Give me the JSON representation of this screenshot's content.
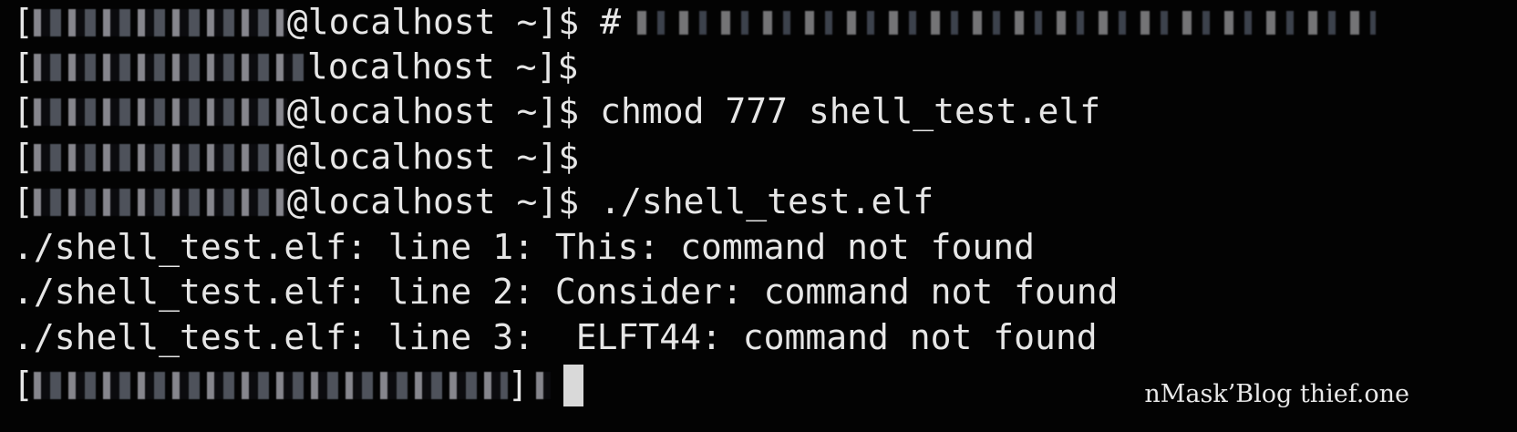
{
  "terminal": {
    "lines": [
      {
        "prompt_user": "[",
        "prompt_host": "@localhost ~]$",
        "command": "#"
      },
      {
        "prompt_user": "[",
        "prompt_host": "localhost ~]$",
        "command": ""
      },
      {
        "prompt_user": "[",
        "prompt_host": "@localhost ~]$",
        "command": "chmod 777 shell_test.elf"
      },
      {
        "prompt_user": "[",
        "prompt_host": "@localhost ~]$",
        "command": ""
      },
      {
        "prompt_user": "[",
        "prompt_host": "@localhost ~]$",
        "command": "./shell_test.elf"
      }
    ],
    "output": [
      "./shell_test.elf: line 1: This: command not found",
      "./shell_test.elf: line 2: Consider: command not found",
      "./shell_test.elf: line 3:  ELFT44: command not found"
    ],
    "final_prompt": "[",
    "final_prompt_tail": "]"
  },
  "watermark": "nMask’Blog thief.one",
  "colors": {
    "background": "#030303",
    "text": "#e6e6e6",
    "cursor": "#d9d9d9"
  }
}
